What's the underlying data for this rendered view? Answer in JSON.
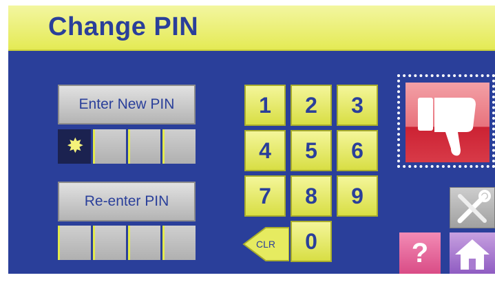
{
  "header": {
    "title": "Change PIN"
  },
  "pin": {
    "new_label": "Enter New PIN",
    "reenter_label": "Re-enter PIN",
    "new_entered": 1,
    "reenter_entered": 0
  },
  "keypad": {
    "keys": [
      "1",
      "2",
      "3",
      "4",
      "5",
      "6",
      "7",
      "8",
      "9",
      "0"
    ],
    "clear_label": "CLR"
  },
  "actions": {
    "cancel_icon": "thumbs-down-icon",
    "settings_icon": "tools-icon",
    "help_label": "?",
    "home_icon": "home-icon"
  },
  "colors": {
    "background": "#2a3f9a",
    "title_bar": "#e4ea55",
    "key": "#e8ec70",
    "text": "#2a3f9a",
    "cancel": "#cc2233",
    "help": "#d94c86",
    "home": "#8f5cc2"
  }
}
